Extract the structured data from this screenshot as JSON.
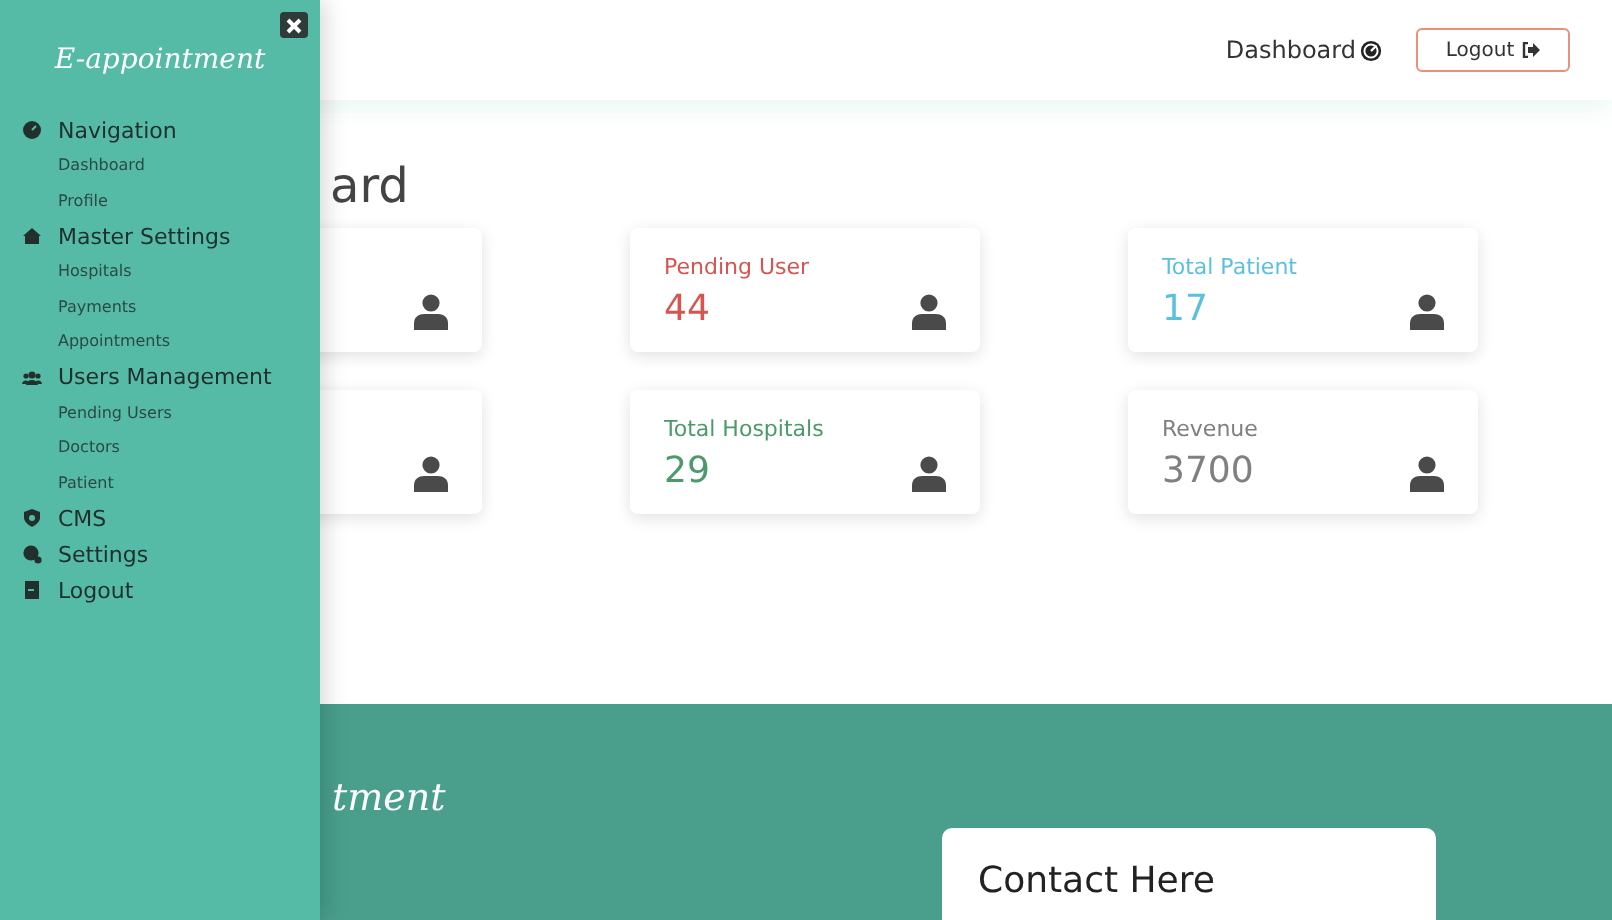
{
  "header": {
    "nav_link": "Dashboard",
    "logout_button": "Logout"
  },
  "page_title": "ard",
  "cards": [
    {
      "kind": "hidden"
    },
    {
      "kind": "stat",
      "title": "Pending User",
      "value": "44",
      "color": "#d9534f"
    },
    {
      "kind": "stat",
      "title": "Total Patient",
      "value": "17",
      "color": "#5bc0de"
    },
    {
      "kind": "hidden"
    },
    {
      "kind": "stat",
      "title": "Total Hospitals",
      "value": "29",
      "color": "#4a9a6a"
    },
    {
      "kind": "stat",
      "title": "Revenue",
      "value": "3700",
      "color": "#808080"
    }
  ],
  "footer": {
    "brand": "tment",
    "contact_title": "Contact Here"
  },
  "sidebar": {
    "brand": "E-appointment",
    "sections": [
      {
        "label": "Navigation",
        "children": [
          {
            "label": "Dashboard"
          },
          {
            "label": "Profile"
          }
        ]
      },
      {
        "label": "Master Settings",
        "children": [
          {
            "label": "Hospitals"
          },
          {
            "label": "Payments"
          },
          {
            "label": "Appointments"
          }
        ]
      },
      {
        "label": "Users Management",
        "children": [
          {
            "label": "Pending Users"
          },
          {
            "label": "Doctors"
          },
          {
            "label": "Patient"
          }
        ]
      },
      {
        "label": "CMS"
      },
      {
        "label": "Settings"
      },
      {
        "label": "Logout"
      }
    ]
  }
}
